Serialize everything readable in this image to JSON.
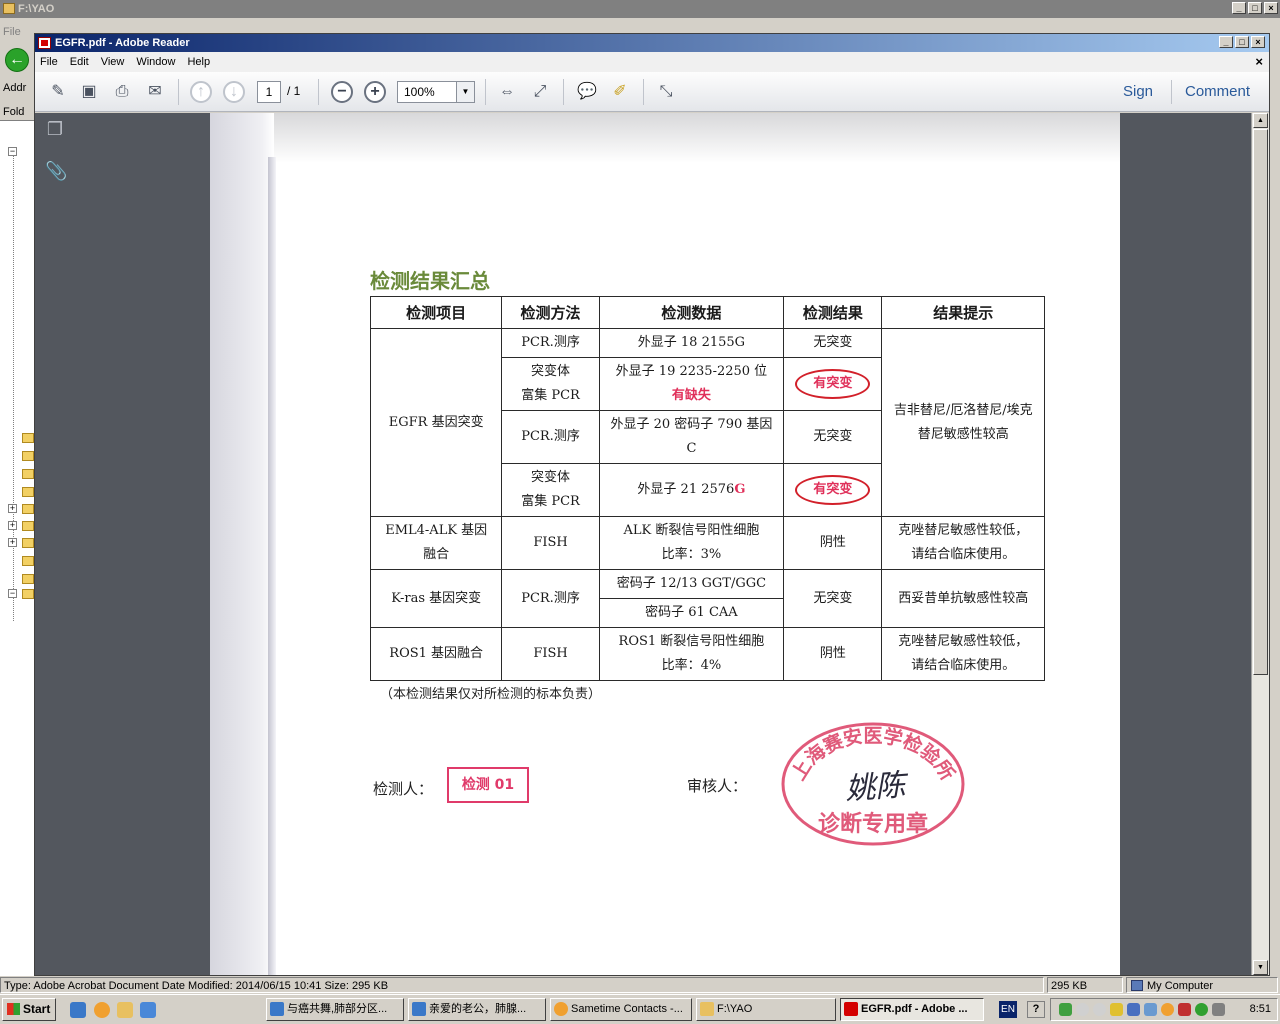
{
  "explorer": {
    "title": "F:\\YAO",
    "menu_file": "File",
    "address_label": "Addr",
    "folders_label": "Fold"
  },
  "reader": {
    "title": "EGFR.pdf - Adobe Reader",
    "menu": [
      "File",
      "Edit",
      "View",
      "Window",
      "Help"
    ],
    "page_current": "1",
    "page_total": "/ 1",
    "zoom": "100%",
    "sign_label": "Sign",
    "comment_label": "Comment"
  },
  "document": {
    "heading": "检测结果汇总",
    "headers": [
      "检测项目",
      "检测方法",
      "检测数据",
      "检测结果",
      "结果提示"
    ],
    "egfr": {
      "item": "EGFR 基因突变",
      "rows": [
        {
          "method": "PCR.测序",
          "data": "外显子 18 2155G",
          "result": "无突变"
        },
        {
          "method_line1": "突变体",
          "method_line2": "富集 PCR",
          "data_line1": "外显子 19 2235-2250 位",
          "data_line2": "有缺失",
          "result": "有突变"
        },
        {
          "method": "PCR.测序",
          "data": "外显子 20  密码子 790 基因 C",
          "result": "无突变"
        },
        {
          "method_line1": "突变体",
          "method_line2": "富集 PCR",
          "data_prefix": "外显子 21 2576",
          "data_suffix": "G",
          "result": "有突变"
        }
      ],
      "hint_line1": "吉非替尼/厄洛替尼/埃克",
      "hint_line2": "替尼敏感性较高"
    },
    "eml4": {
      "item_line1": "EML4-ALK 基因",
      "item_line2": "融合",
      "method": "FISH",
      "data_line1": "ALK 断裂信号阳性细胞",
      "data_line2": "比率：3%",
      "result": "阴性",
      "hint_line1": "克唑替尼敏感性较低，",
      "hint_line2": "请结合临床使用。"
    },
    "kras": {
      "item": "K-ras 基因突变",
      "method": "PCR.测序",
      "data_line1": "密码子 12/13 GGT/GGC",
      "data_line2": "密码子 61 CAA",
      "result": "无突变",
      "hint": "西妥昔单抗敏感性较高"
    },
    "ros1": {
      "item": "ROS1 基因融合",
      "method": "FISH",
      "data_line1": "ROS1 断裂信号阳性细胞",
      "data_line2": "比率：4%",
      "result": "阴性",
      "hint_line1": "克唑替尼敏感性较低，",
      "hint_line2": "请结合临床使用。"
    },
    "disclaimer": "（本检测结果仅对所检测的标本负责）",
    "tester_label": "检测人：",
    "tester_stamp": "检测 01",
    "reviewer_label": "审核人：",
    "seal_top": "上海赛安医学检验所",
    "seal_bottom": "诊断专用章",
    "signature": "姚陈"
  },
  "statusbar": {
    "info": "Type: Adobe Acrobat Document Date Modified: 2014/06/15 10:41 Size: 295 KB",
    "size": "295 KB",
    "location": "My Computer"
  },
  "taskbar": {
    "start": "Start",
    "tasks": [
      "与癌共舞,肺部分区...",
      "亲爱的老公，肺腺...",
      "Sametime Contacts -...",
      "F:\\YAO",
      "EGFR.pdf - Adobe ..."
    ],
    "lang": "EN",
    "help": "?",
    "clock": "8:51"
  },
  "colors": {
    "reader_titlebar": "#0a246a",
    "heading_green": "#6a8a3a",
    "mutation_red": "#e0305a",
    "seal_pink": "#e05a7a"
  }
}
